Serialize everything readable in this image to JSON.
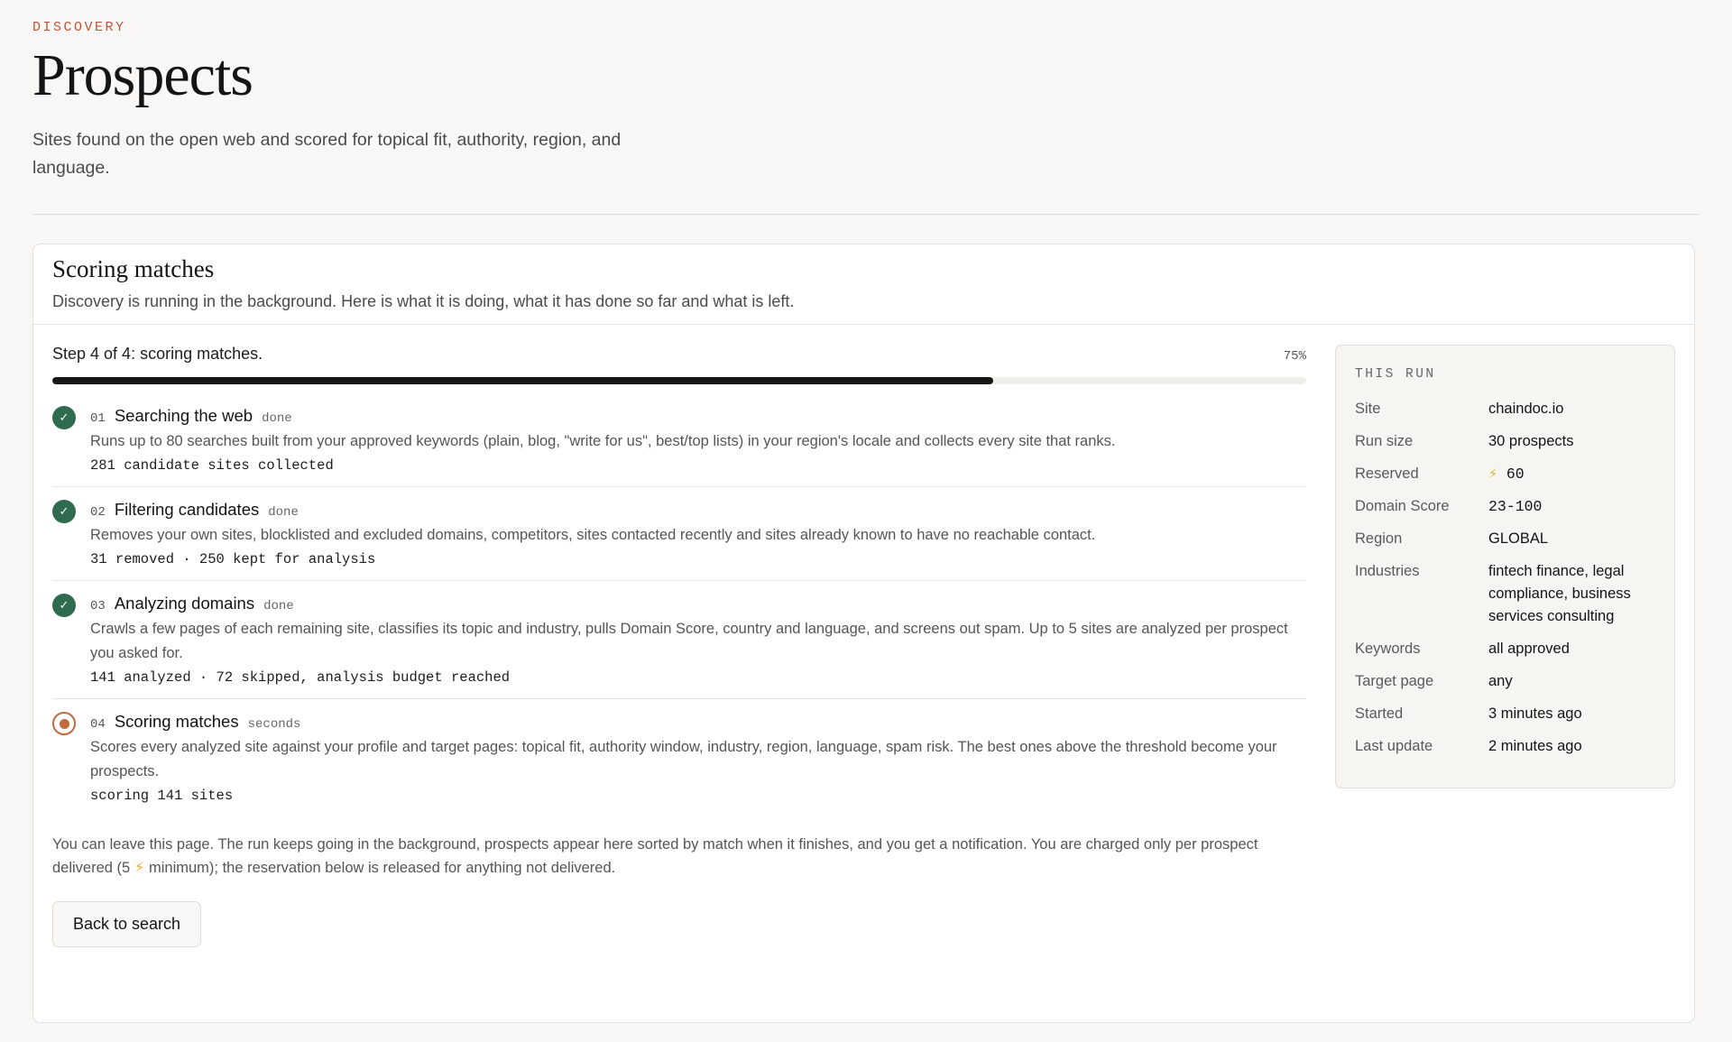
{
  "header": {
    "eyebrow": "DISCOVERY",
    "title": "Prospects",
    "subtitle": "Sites found on the open web and scored for topical fit, authority, region, and language."
  },
  "card": {
    "title": "Scoring matches",
    "description": "Discovery is running in the background. Here is what it is doing, what it has done so far and what is left."
  },
  "progress": {
    "step_text": "Step 4 of 4: scoring matches.",
    "percent_label": "75%",
    "fraction": 0.75
  },
  "steps": [
    {
      "num": "01",
      "name": "Searching the web",
      "status": "done",
      "state": "done",
      "description": "Runs up to 80 searches built from your approved keywords (plain, blog, \"write for us\", best/top lists) in your region's locale and collects every site that ranks.",
      "meta": "281 candidate sites collected"
    },
    {
      "num": "02",
      "name": "Filtering candidates",
      "status": "done",
      "state": "done",
      "description": "Removes your own sites, blocklisted and excluded domains, competitors, sites contacted recently and sites already known to have no reachable contact.",
      "meta": "31 removed · 250 kept for analysis"
    },
    {
      "num": "03",
      "name": "Analyzing domains",
      "status": "done",
      "state": "done",
      "description": "Crawls a few pages of each remaining site, classifies its topic and industry, pulls Domain Score, country and language, and screens out spam. Up to 5 sites are analyzed per prospect you asked for.",
      "meta": "141 analyzed · 72 skipped, analysis budget reached"
    },
    {
      "num": "04",
      "name": "Scoring matches",
      "status": "seconds",
      "state": "active",
      "description": "Scores every analyzed site against your profile and target pages: topical fit, authority window, industry, region, language, spam risk. The best ones above the threshold become your prospects.",
      "meta": "scoring 141 sites"
    }
  ],
  "note": {
    "before": "You can leave this page. The run keeps going in the background, prospects appear here sorted by match when it finishes, and you get a notification. You are charged only per prospect delivered (5 ",
    "bolt": "⚡",
    "after": " minimum); the reservation below is released for anything not delivered."
  },
  "back_button": "Back to search",
  "run": {
    "title": "THIS RUN",
    "rows": [
      {
        "key": "Site",
        "value": "chaindoc.io"
      },
      {
        "key": "Run size",
        "value": "30 prospects"
      },
      {
        "key": "Reserved",
        "value": "60",
        "bolt": "⚡"
      },
      {
        "key": "Domain Score",
        "value": "23-100"
      },
      {
        "key": "Region",
        "value": "GLOBAL"
      },
      {
        "key": "Industries",
        "value": "fintech finance, legal compliance, business services consulting"
      },
      {
        "key": "Keywords",
        "value": "all approved"
      },
      {
        "key": "Target page",
        "value": "any"
      },
      {
        "key": "Started",
        "value": "3 minutes ago"
      },
      {
        "key": "Last update",
        "value": "2 minutes ago"
      }
    ]
  },
  "colors": {
    "accent": "#c0553a",
    "done_icon": "#2f6b4d",
    "active_icon": "#c0693f",
    "progress_fill": "#161616",
    "bolt": "#e4b33a"
  },
  "icons": {
    "done": "check-icon",
    "active": "in-progress-icon",
    "bolt": "lightning-icon"
  }
}
